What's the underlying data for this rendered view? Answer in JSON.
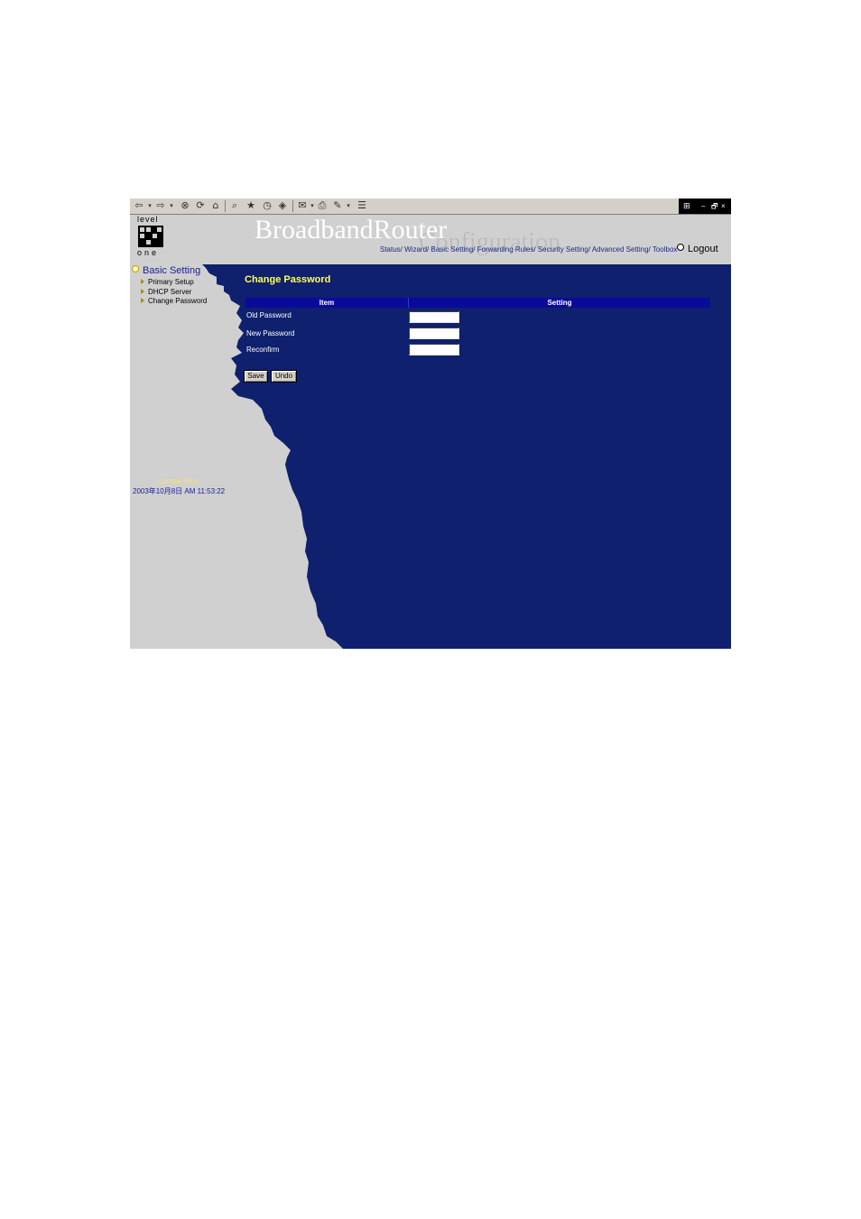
{
  "toolbar": {
    "icons": [
      "back-icon",
      "forward-icon",
      "stop-icon",
      "refresh-icon",
      "home-icon",
      "search-icon",
      "favorites-icon",
      "history-icon",
      "channels-icon",
      "mail-icon",
      "print-icon",
      "edit-icon",
      "discuss-icon"
    ],
    "window_controls": {
      "minimize": "–",
      "restore": "🗗",
      "close": "×"
    }
  },
  "header": {
    "logo_top": "level",
    "logo_bottom": "one",
    "brand_primary": "BroadbandRouter",
    "brand_secondary": "Configuration",
    "nav": [
      "Status/",
      "Wizard/",
      "Basic Setting/",
      "Forwarding Rules/",
      "Security Setting/",
      "Advanced Setting/",
      "Toolbox"
    ],
    "logout": "Logout"
  },
  "sidebar": {
    "title": "Basic Setting",
    "items": [
      "Primary Setup",
      "DHCP Server",
      "Change Password"
    ],
    "current_time_label": "Current Time",
    "current_time_value": "2003年10月8日 AM 11:53:22"
  },
  "main": {
    "title": "Change Password",
    "table": {
      "headers": [
        "Item",
        "Setting"
      ],
      "rows": [
        {
          "label": "Old Password",
          "value": ""
        },
        {
          "label": "New Password",
          "value": ""
        },
        {
          "label": "Reconfirm",
          "value": ""
        }
      ]
    },
    "buttons": {
      "save": "Save",
      "undo": "Undo"
    }
  },
  "colors": {
    "page_bg": "#0f206e",
    "sidebar_bg": "#d0d0d0",
    "title_accent": "#ffff55",
    "table_header": "#0a0a9a"
  }
}
